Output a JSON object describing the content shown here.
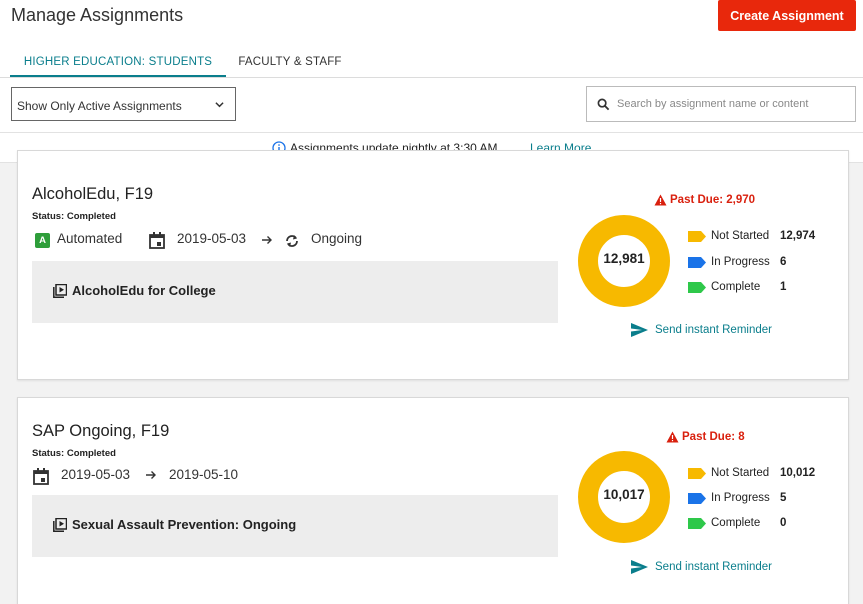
{
  "header": {
    "title": "Manage Assignments",
    "create_label": "Create Assignment",
    "accent": "#e8280c"
  },
  "tabs": [
    {
      "label": "HIGHER EDUCATION: STUDENTS",
      "active": true
    },
    {
      "label": "FACULTY & STAFF",
      "active": false
    }
  ],
  "filter": {
    "selected": "Show Only Active Assignments"
  },
  "search": {
    "placeholder": "Search by assignment name or content",
    "value": ""
  },
  "info": {
    "text": "Assignments update nightly at 3:30 AM …",
    "link": "Learn More"
  },
  "colors": {
    "teal": "#0a7e8c",
    "not_started": "#f7b900",
    "in_progress": "#1a73e8",
    "complete": "#2ec84a",
    "past_due": "#d9200e"
  },
  "assignments": [
    {
      "title": "AlcoholEdu, F19",
      "status": "Status: Completed",
      "badge": "A",
      "type": "Automated",
      "start_date": "2019-05-03",
      "end": "Ongoing",
      "module": "AlcoholEdu for College",
      "past_due": "Past Due: 2,970",
      "total": "12,981",
      "legend": [
        {
          "label": "Not Started",
          "value": "12,974",
          "count": 12974
        },
        {
          "label": "In Progress",
          "value": "6",
          "count": 6
        },
        {
          "label": "Complete",
          "value": "1",
          "count": 1
        }
      ],
      "reminder": "Send instant Reminder"
    },
    {
      "title": "SAP Ongoing, F19",
      "status": "Status: Completed",
      "start_date": "2019-05-03",
      "end_date": "2019-05-10",
      "module": "Sexual Assault Prevention: Ongoing",
      "past_due": "Past Due: 8",
      "total": "10,017",
      "legend": [
        {
          "label": "Not Started",
          "value": "10,012",
          "count": 10012
        },
        {
          "label": "In Progress",
          "value": "5",
          "count": 5
        },
        {
          "label": "Complete",
          "value": "0",
          "count": 0
        }
      ],
      "reminder": "Send instant Reminder"
    }
  ]
}
